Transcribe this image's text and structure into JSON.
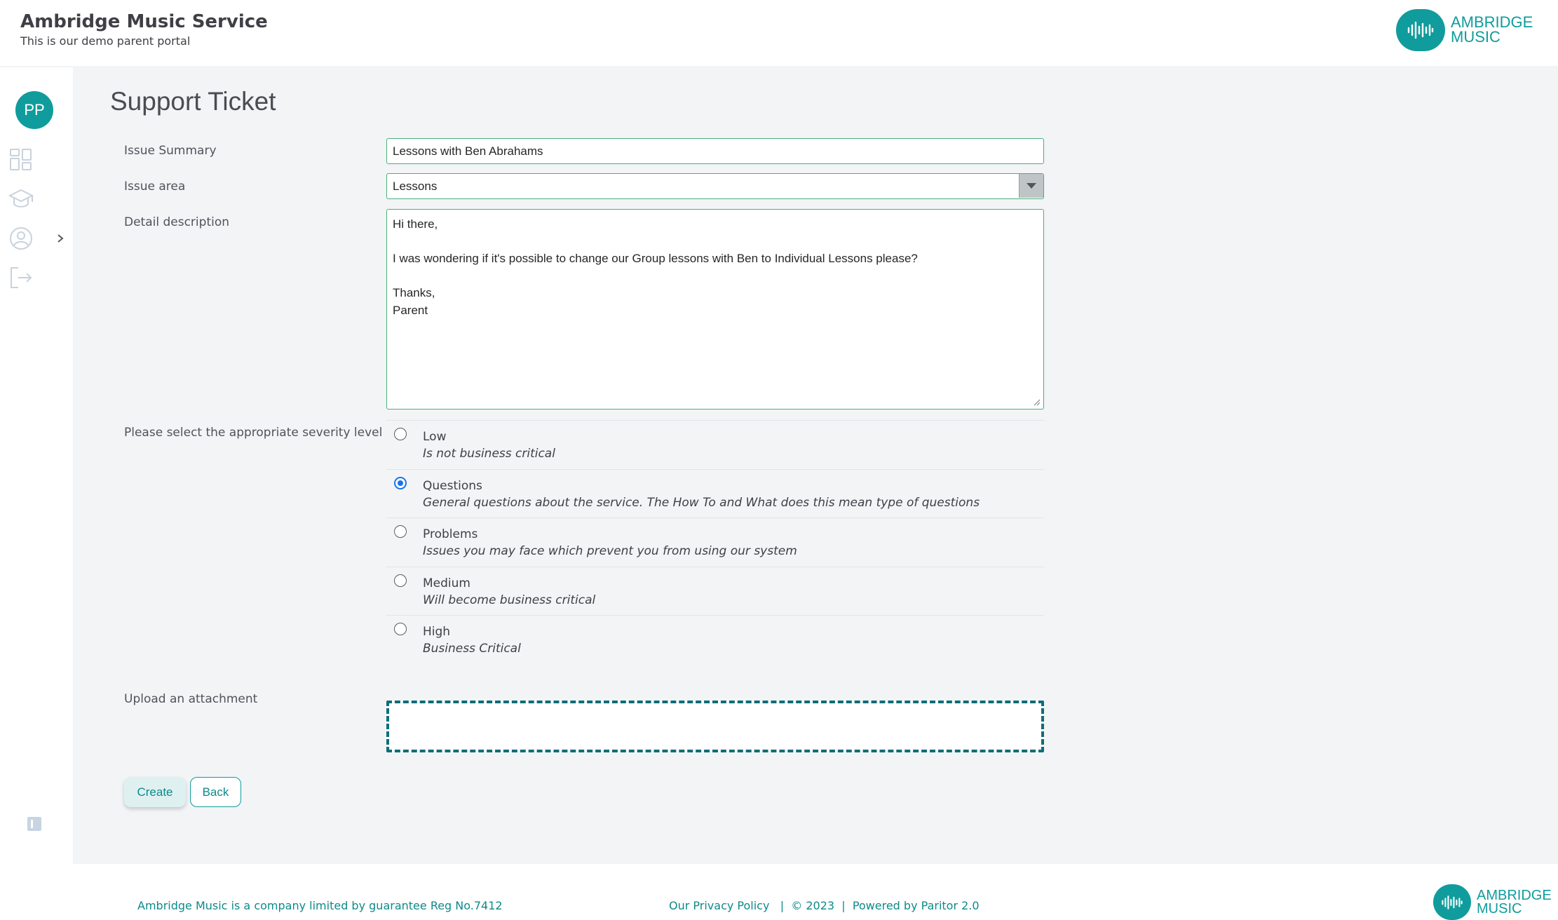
{
  "header": {
    "title": "Ambridge Music Service",
    "subtitle": "This is our demo parent portal",
    "logo_line1": "AMBRIDGE",
    "logo_line2": "MUSIC"
  },
  "sidebar": {
    "avatar_initials": "PP",
    "icons": [
      "dashboard-icon",
      "graduation-cap-icon",
      "user-circle-icon",
      "logout-icon"
    ]
  },
  "page": {
    "title": "Support Ticket"
  },
  "form": {
    "issue_summary_label": "Issue Summary",
    "issue_summary_value": "Lessons with Ben Abrahams",
    "issue_area_label": "Issue area",
    "issue_area_value": "Lessons",
    "detail_label": "Detail description",
    "detail_value": "Hi there,\n\nI was wondering if it's possible to change our Group lessons with Ben to Individual Lessons please?\n\nThanks,\nParent",
    "severity_label": "Please select the appropriate severity level",
    "severity_options": [
      {
        "label": "Low",
        "desc": "Is not business critical",
        "checked": false
      },
      {
        "label": "Questions",
        "desc": "General questions about the service. The How To and What does this mean type of questions",
        "checked": true
      },
      {
        "label": "Problems",
        "desc": "Issues you may face which prevent you from using our system",
        "checked": false
      },
      {
        "label": "Medium",
        "desc": "Will become business critical",
        "checked": false
      },
      {
        "label": "High",
        "desc": "Business Critical",
        "checked": false
      }
    ],
    "upload_label": "Upload an attachment",
    "create_label": "Create",
    "back_label": "Back"
  },
  "footer": {
    "company_text": "Ambridge Music is a company limited by guarantee Reg No.7412",
    "privacy_link": "Our Privacy Policy",
    "separator": "|",
    "copyright": "© 2023",
    "powered_by": "Powered by Paritor 2.0",
    "logo_line1": "AMBRIDGE",
    "logo_line2": "MUSIC"
  },
  "colors": {
    "accent": "#109c9c",
    "field_border": "#4caf7d",
    "radio_checked": "#1a73e8",
    "upload_border": "#0e6e78"
  }
}
